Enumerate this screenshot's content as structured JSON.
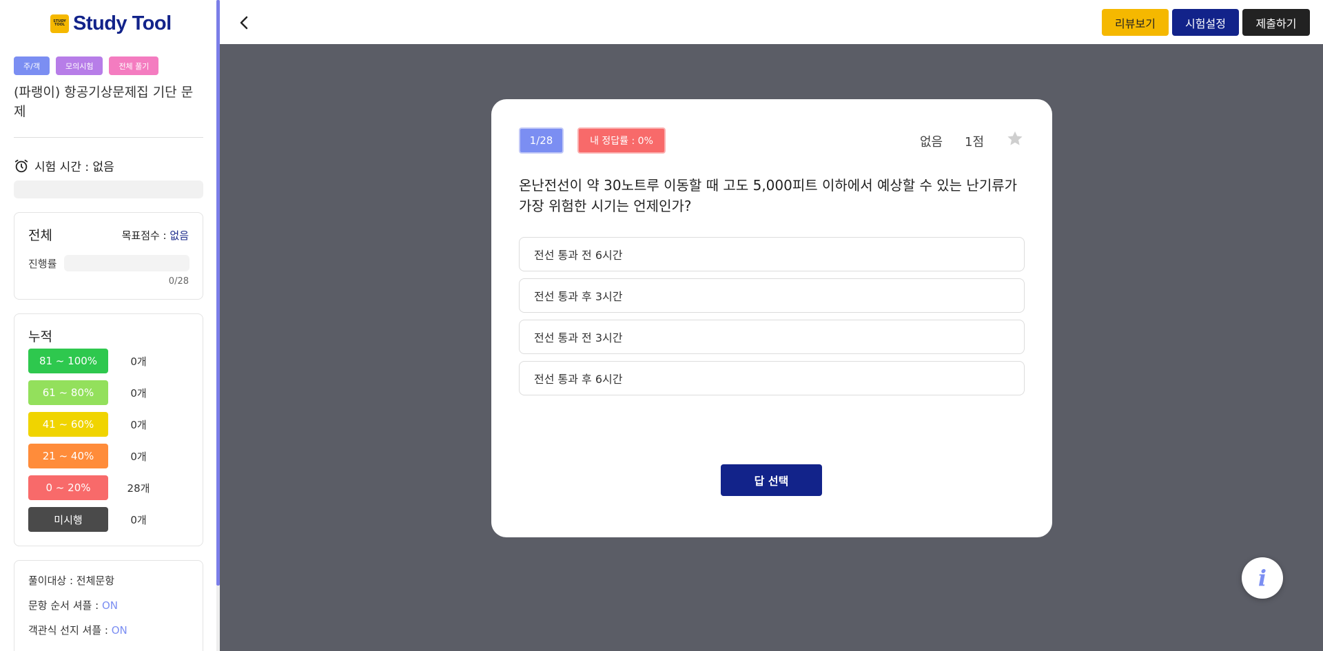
{
  "brand": {
    "logo_badge_top": "STUDY",
    "logo_badge_bottom": "TOOL",
    "name": "Study Tool"
  },
  "sidebar": {
    "tags": [
      "주/객",
      "모의시험",
      "전체 풀기"
    ],
    "exam_title": "(파랭이) 항공기상문제집 기단 문제",
    "timer_label": "시험 시간 : 없음",
    "progress_card": {
      "title": "전체",
      "goal_label": "목표점수 : ",
      "goal_value": "없음",
      "progress_label": "진행률",
      "progress_fraction": 0,
      "progress_count": "0/28"
    },
    "accumulated": {
      "title": "누적",
      "rows": [
        {
          "range": "81 ~ 100%",
          "count": "0개",
          "color": "#2ec84e"
        },
        {
          "range": "61 ~ 80%",
          "count": "0개",
          "color": "#93e05c"
        },
        {
          "range": "41 ~ 60%",
          "count": "0개",
          "color": "#f0d400"
        },
        {
          "range": "21 ~ 40%",
          "count": "0개",
          "color": "#ff8c3a"
        },
        {
          "range": "0 ~ 20%",
          "count": "28개",
          "color": "#f86a6a"
        },
        {
          "range": "미시행",
          "count": "0개",
          "color": "#4a4a4a"
        }
      ]
    },
    "info": {
      "target_label": "풀이대상 : ",
      "target_value": "전체문항",
      "shuffle_q_label": "문항 순서 셔플 : ",
      "shuffle_q_value": "ON",
      "shuffle_c_label": "객관식 선지 셔플 : ",
      "shuffle_c_value": "ON"
    }
  },
  "topbar": {
    "review_label": "리뷰보기",
    "settings_label": "시험설정",
    "submit_label": "제출하기"
  },
  "question": {
    "number": "1/28",
    "my_rate": "내 정답률 : 0%",
    "category": "없음",
    "points": "1점",
    "text": "온난전선이 약 30노트루 이동할 때 고도 5,000피트 이하에서 예상할 수 있는 난기류가 가장 위험한 시기는 언제인가?",
    "choices": [
      "전선 통과 전 6시간",
      "전선 통과 후 3시간",
      "전선 통과 전 3시간",
      "전선 통과 후 6시간"
    ],
    "select_label": "답 선택"
  },
  "fab": {
    "label": "i"
  },
  "colors": {
    "accent": "#7b8ef2",
    "navy": "#12238a",
    "yellow": "#f5b800"
  }
}
